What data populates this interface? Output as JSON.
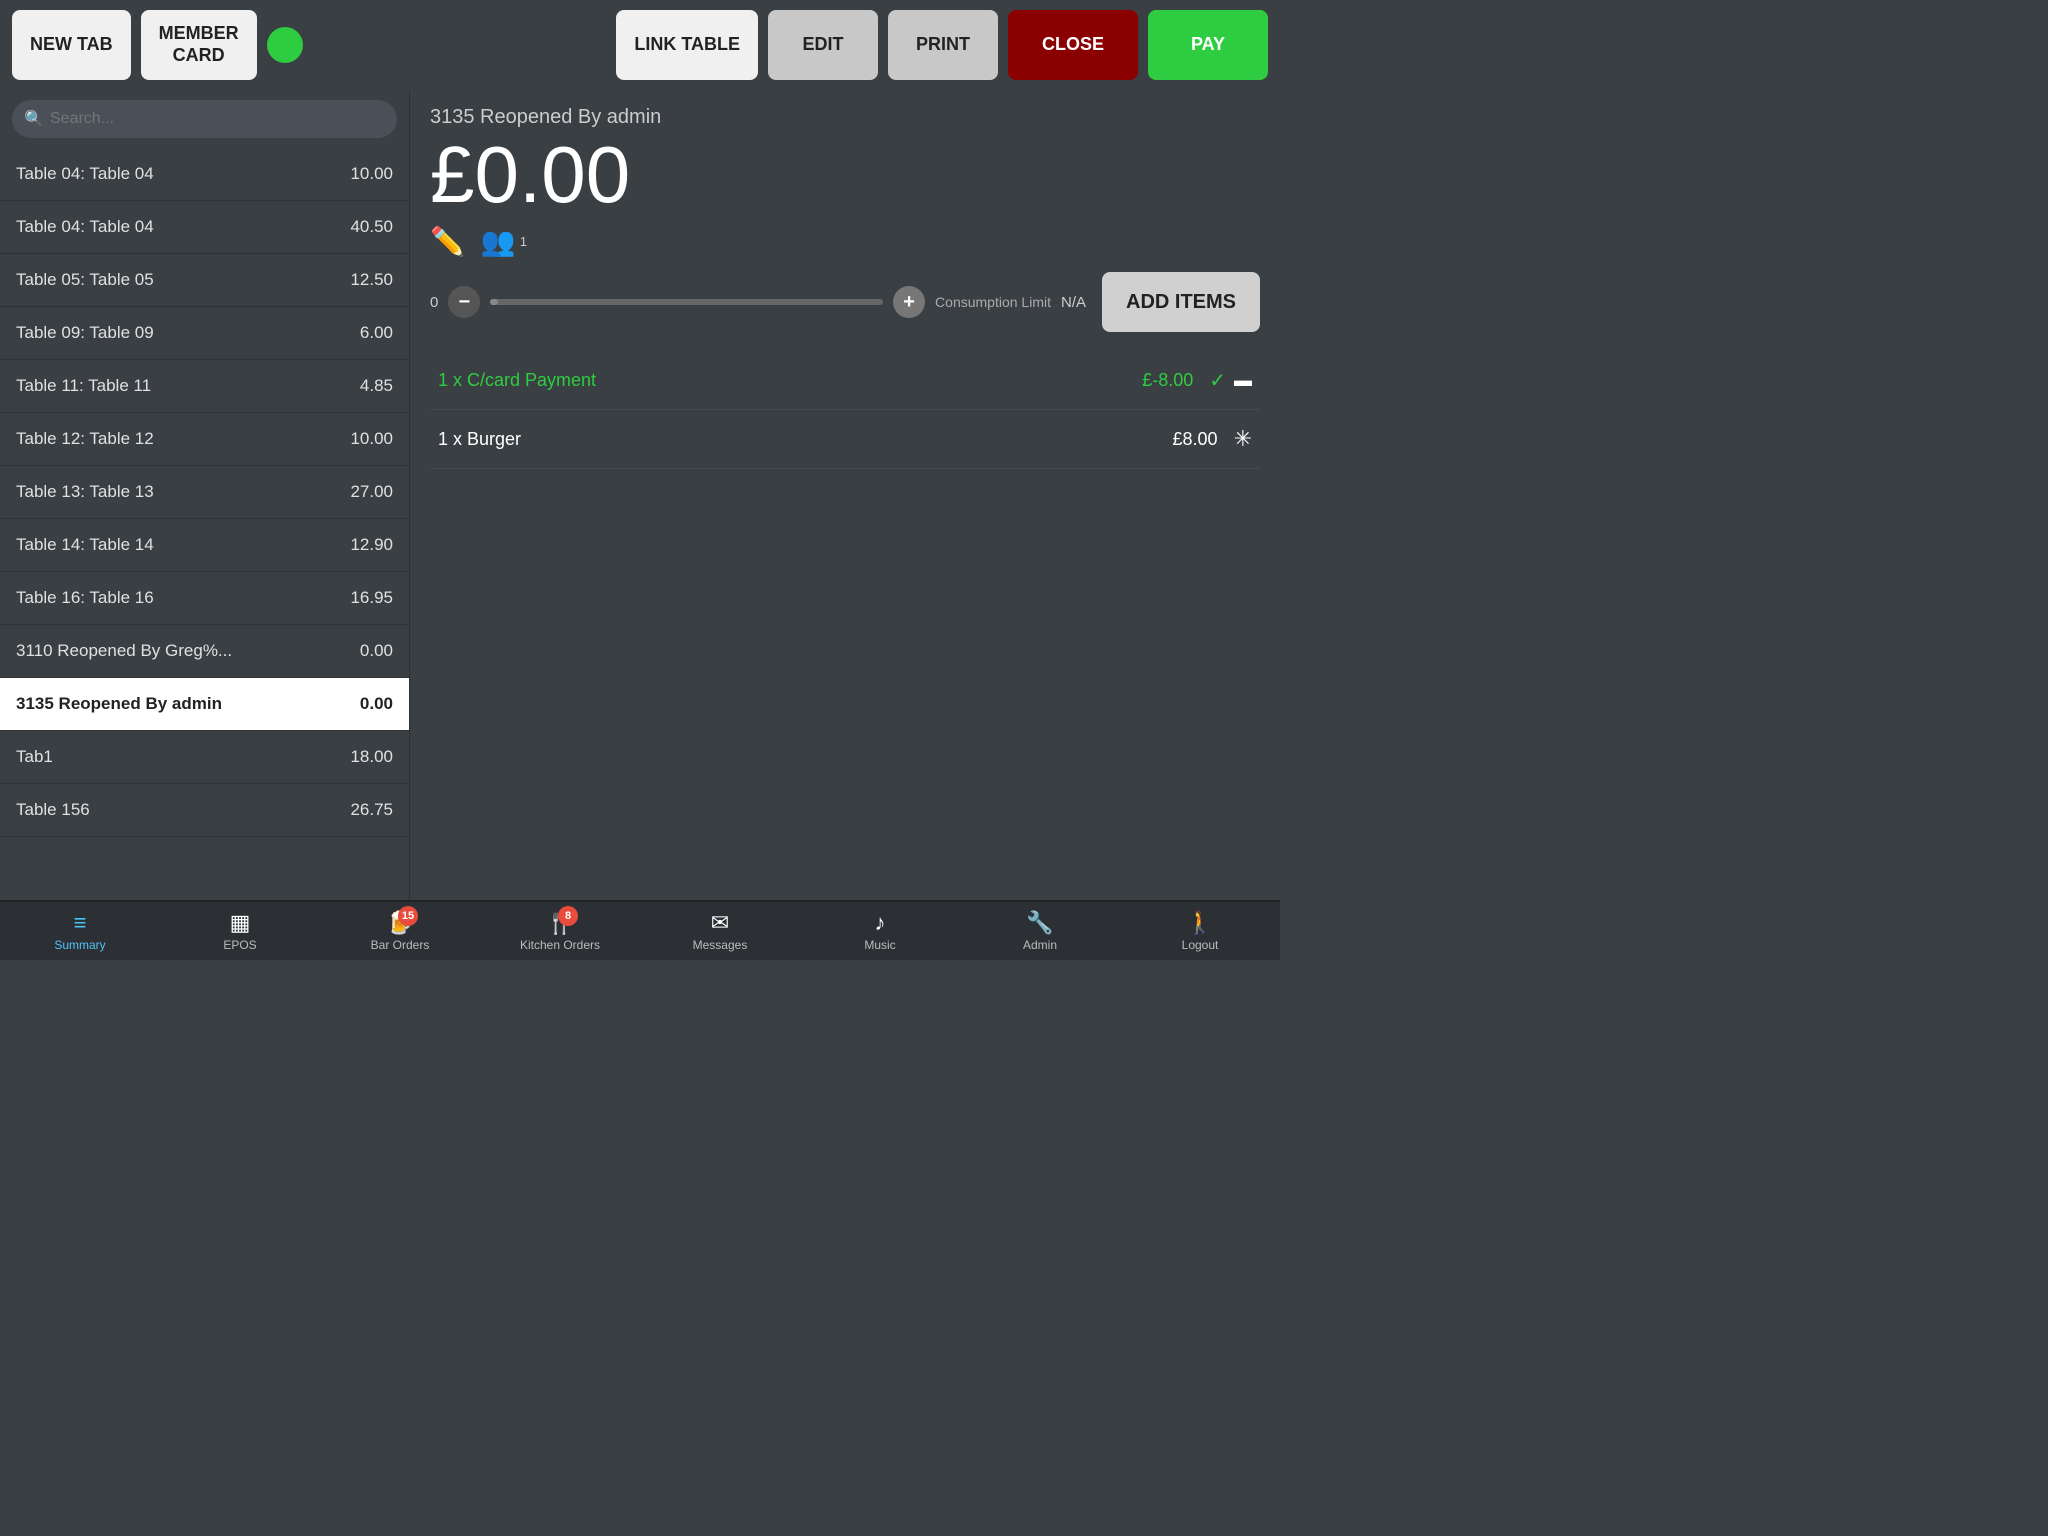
{
  "toolbar": {
    "new_tab_label": "NEW TAB",
    "member_card_label": "MEMBER\nCARD",
    "link_table_label": "LINK TABLE",
    "edit_label": "EDIT",
    "print_label": "PRINT",
    "close_label": "CLOSE",
    "pay_label": "PAY"
  },
  "search": {
    "placeholder": "Search..."
  },
  "tabs": [
    {
      "name": "Table 04: Table 04",
      "amount": "10.00"
    },
    {
      "name": "Table 04: Table 04",
      "amount": "40.50"
    },
    {
      "name": "Table 05: Table 05",
      "amount": "12.50"
    },
    {
      "name": "Table 09: Table 09",
      "amount": "6.00"
    },
    {
      "name": "Table 11: Table 11",
      "amount": "4.85"
    },
    {
      "name": "Table 12: Table 12",
      "amount": "10.00"
    },
    {
      "name": "Table 13: Table 13",
      "amount": "27.00"
    },
    {
      "name": "Table 14: Table 14",
      "amount": "12.90"
    },
    {
      "name": "Table 16: Table 16",
      "amount": "16.95"
    },
    {
      "name": "3110 Reopened By Greg%...",
      "amount": "0.00"
    },
    {
      "name": "3135 Reopened By admin",
      "amount": "0.00",
      "active": true
    },
    {
      "name": "Tab1",
      "amount": "18.00"
    },
    {
      "name": "Table 156",
      "amount": "26.75"
    }
  ],
  "order": {
    "title": "3135 Reopened By admin",
    "total": "£0.00",
    "slider_min": "0",
    "consumption_label": "Consumption Limit",
    "consumption_value": "N/A",
    "add_items_label": "ADD ITEMS",
    "guests_count": "1",
    "items": [
      {
        "name": "1 x C/card Payment",
        "price": "£-8.00",
        "type": "payment"
      },
      {
        "name": "1 x Burger",
        "price": "£8.00",
        "type": "normal"
      }
    ]
  },
  "bottom_nav": [
    {
      "label": "Summary",
      "icon": "≡",
      "active": true
    },
    {
      "label": "EPOS",
      "icon": "▦",
      "active": false
    },
    {
      "label": "Bar Orders",
      "icon": "🍺",
      "badge": "15",
      "active": false
    },
    {
      "label": "Kitchen Orders",
      "icon": "🍴",
      "badge": "8",
      "active": false
    },
    {
      "label": "Messages",
      "icon": "✉",
      "active": false
    },
    {
      "label": "Music",
      "icon": "♪",
      "active": false
    },
    {
      "label": "Admin",
      "icon": "🔧",
      "active": false
    },
    {
      "label": "Logout",
      "icon": "🚶",
      "active": false
    }
  ]
}
